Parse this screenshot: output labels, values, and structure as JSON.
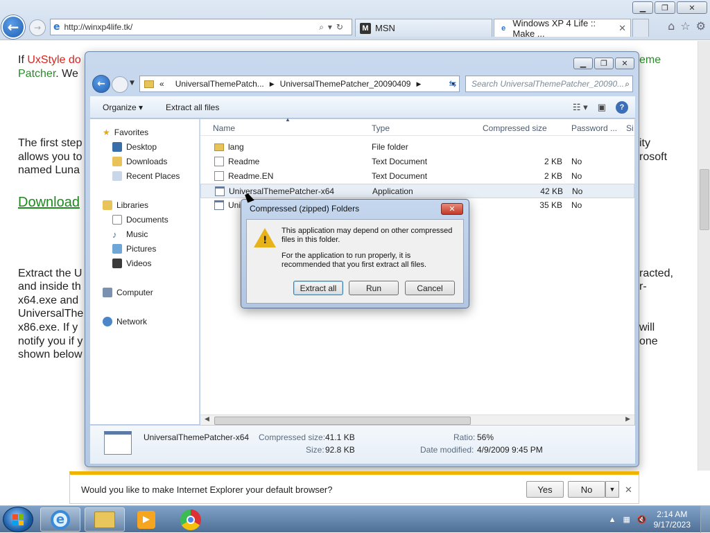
{
  "browser": {
    "url": "http://winxp4life.tk/",
    "tabs": [
      {
        "label": "MSN"
      },
      {
        "label": "Windows XP 4 Life :: Make ..."
      }
    ]
  },
  "page": {
    "line1_prefix": "If ",
    "line1_red": "UxStyle do",
    "line1_right": "eme",
    "line2_green": "Patcher",
    "line2_rest": ".  We",
    "p1_l1": "The first step",
    "p1_l1_right": "ity",
    "p1_l2": "allows you to",
    "p1_l2_right": "rosoft",
    "p1_l3": "named Luna",
    "download_link": "Download",
    "p2_l1": "Extract the U",
    "p2_l1_right": "racted,",
    "p2_l2": "and inside th",
    "p2_l2_right": "r-",
    "p2_l3": "x64.exe and",
    "p2_l4": "UniversalThe",
    "p2_l5": "x86.exe.  If y",
    "p2_l5_right": "will",
    "p2_l6": "notify you if y",
    "p2_l6_right": "one",
    "p2_l7": "shown below"
  },
  "explorer": {
    "breadcrumb": [
      "«",
      "UniversalThemePatch...",
      "UniversalThemePatcher_20090409"
    ],
    "search_placeholder": "Search UniversalThemePatcher_20090...",
    "toolbar": {
      "organize": "Organize",
      "extract_all": "Extract all files"
    },
    "nav": {
      "favorites": "Favorites",
      "desktop": "Desktop",
      "downloads": "Downloads",
      "recent": "Recent Places",
      "libraries": "Libraries",
      "documents": "Documents",
      "music": "Music",
      "pictures": "Pictures",
      "videos": "Videos",
      "computer": "Computer",
      "network": "Network"
    },
    "columns": {
      "name": "Name",
      "type": "Type",
      "compressed": "Compressed size",
      "password": "Password ...",
      "size": "Si"
    },
    "files": [
      {
        "name": "lang",
        "type": "File folder",
        "size": "",
        "password": ""
      },
      {
        "name": "Readme",
        "type": "Text Document",
        "size": "2 KB",
        "password": "No"
      },
      {
        "name": "Readme.EN",
        "type": "Text Document",
        "size": "2 KB",
        "password": "No"
      },
      {
        "name": "UniversalThemePatcher-x64",
        "type": "Application",
        "size": "42 KB",
        "password": "No"
      },
      {
        "name": "Uni",
        "type": "",
        "size": "35 KB",
        "password": "No"
      }
    ],
    "details": {
      "name": "UniversalThemePatcher-x64",
      "compressed_label": "Compressed size:",
      "compressed_value": "41.1 KB",
      "size_label": "Size:",
      "size_value": "92.8 KB",
      "ratio_label": "Ratio:",
      "ratio_value": "56%",
      "modified_label": "Date modified:",
      "modified_value": "4/9/2009 9:45 PM"
    }
  },
  "dialog": {
    "title": "Compressed (zipped) Folders",
    "msg1": "This application may depend on other compressed files in this folder.",
    "msg2": "For the application to run properly, it is recommended that you first extract all files.",
    "extract_all": "Extract all",
    "run": "Run",
    "cancel": "Cancel"
  },
  "notification": {
    "text": "Would you like to make Internet Explorer your default browser?",
    "yes": "Yes",
    "no": "No"
  },
  "taskbar": {
    "time": "2:14 AM",
    "date": "9/17/2023"
  }
}
